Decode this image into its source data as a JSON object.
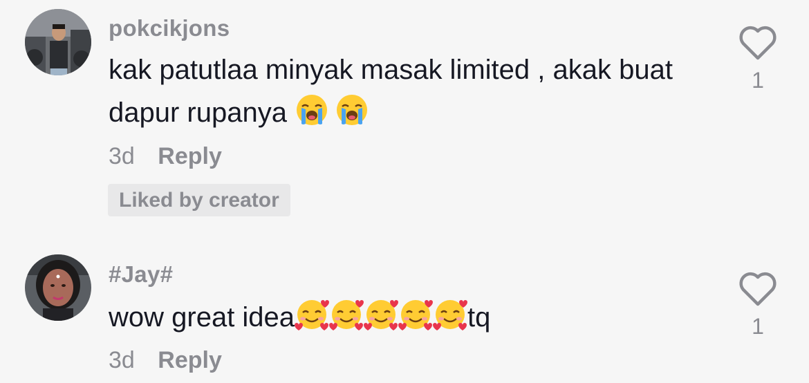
{
  "comments": [
    {
      "username": "pokcikjons",
      "text_before": "kak patutlaa minyak masak limited , akak buat dapur rupanya ",
      "emoji_1": "😭",
      "emoji_2": "😭",
      "time": "3d",
      "reply_label": "Reply",
      "badge": "Liked by creator",
      "like_count": "1"
    },
    {
      "username": "#Jay#",
      "text_before": "wow great idea",
      "emojis": [
        "🥰",
        "🥰",
        "🥰",
        "🥰",
        "🥰"
      ],
      "text_after": "tq",
      "time": "3d",
      "reply_label": "Reply",
      "like_count": "1"
    }
  ],
  "icons": {
    "like": "heart-outline-icon",
    "crying": "loudly-crying-face-emoji",
    "hearts": "smiling-face-with-hearts-emoji"
  },
  "colors": {
    "background": "#f6f6f6",
    "text": "#161823",
    "muted": "#8a8b91",
    "badge_bg": "#e8e8e9"
  }
}
